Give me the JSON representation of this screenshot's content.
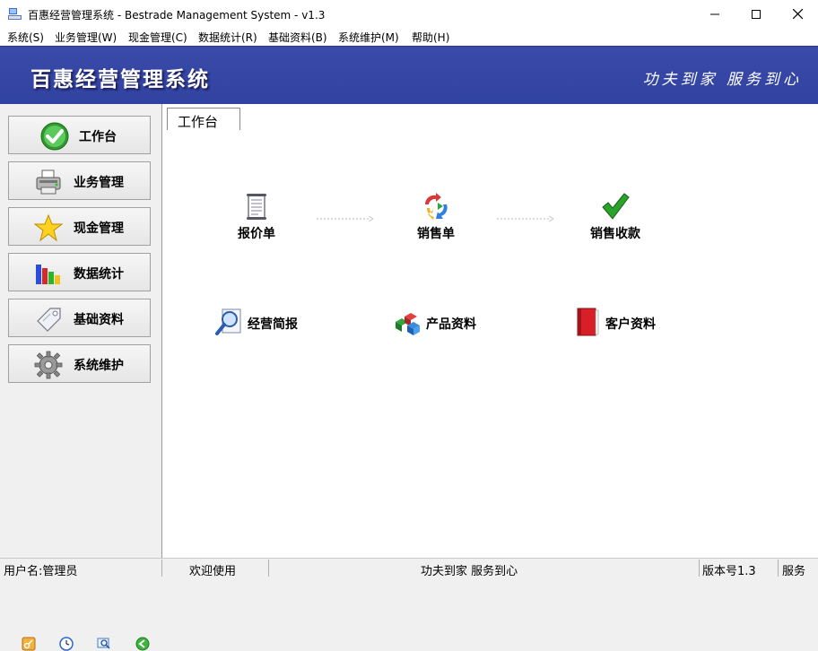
{
  "window": {
    "title": "百惠经营管理系统 - Bestrade Management System - v1.3",
    "min_glyph": "—",
    "max_glyph": "☐",
    "close_glyph": "✕"
  },
  "menu": [
    "系统(S)",
    "业务管理(W)",
    "现金管理(C)",
    "数据统计(R)",
    "基础资料(B)",
    "系统维护(M)",
    "帮助(H)"
  ],
  "banner": {
    "title": "百惠经营管理系统",
    "slogan": "功夫到家 服务到心",
    "color": "#3a4aa8"
  },
  "sidebar": {
    "items": [
      {
        "label": "工作台",
        "icon": "checkmark-circle-icon"
      },
      {
        "label": "业务管理",
        "icon": "printer-icon"
      },
      {
        "label": "现金管理",
        "icon": "star-icon"
      },
      {
        "label": "数据统计",
        "icon": "bar-chart-icon"
      },
      {
        "label": "基础资料",
        "icon": "tag-icon"
      },
      {
        "label": "系统维护",
        "icon": "gear-icon"
      }
    ],
    "tools": [
      "key-icon",
      "clock-icon",
      "search-icon",
      "back-arrow-icon"
    ]
  },
  "main": {
    "tab": "工作台",
    "workflow": [
      {
        "label": "报价单",
        "icon": "scroll-icon"
      },
      {
        "label": "销售单",
        "icon": "recycle-arrows-icon"
      },
      {
        "label": "销售收款",
        "icon": "green-check-icon"
      }
    ],
    "shortcuts": [
      {
        "label": "经营简报",
        "icon": "magnifier-doc-icon"
      },
      {
        "label": "产品资料",
        "icon": "cubes-icon"
      },
      {
        "label": "客户资料",
        "icon": "red-book-icon"
      }
    ]
  },
  "status": {
    "user": "用户名:管理员",
    "welcome": "欢迎使用",
    "slogan": "功夫到家 服务到心",
    "version": "版本号1.3",
    "extra": "服务"
  }
}
